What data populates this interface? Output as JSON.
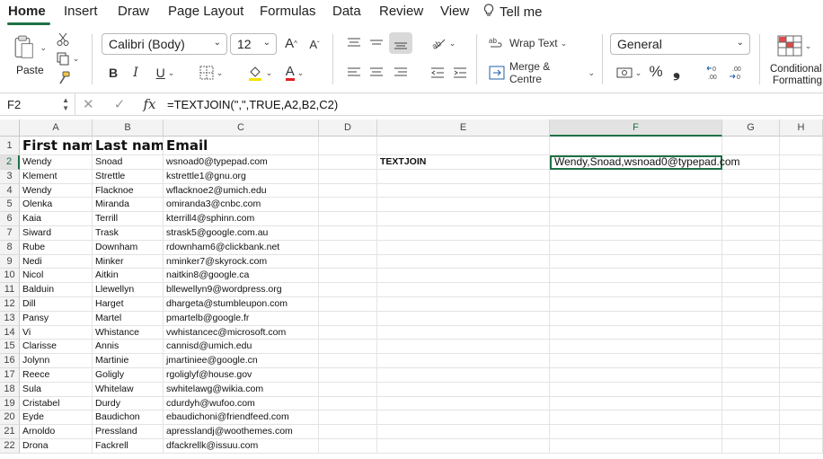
{
  "tabs": [
    "Home",
    "Insert",
    "Draw",
    "Page Layout",
    "Formulas",
    "Data",
    "Review",
    "View",
    "Tell me"
  ],
  "ribbon": {
    "paste": "Paste",
    "font_name": "Calibri (Body)",
    "font_size": "12",
    "wrap_text": "Wrap Text",
    "merge": "Merge & Centre",
    "number_format": "General",
    "conditional": "Conditional",
    "formatting": "Formatting",
    "bold": "B",
    "italic": "I",
    "underline": "U",
    "percent": "%",
    "comma": "❟",
    "font_color": "A",
    "grow": "A",
    "shrink": "A"
  },
  "formula_bar": {
    "name": "F2",
    "fx": "fx",
    "formula": "=TEXTJOIN(\",\",TRUE,A2,B2,C2)"
  },
  "columns": [
    "A",
    "B",
    "C",
    "D",
    "E",
    "F",
    "G",
    "H"
  ],
  "header_row": [
    "First name",
    "Last name",
    "Email"
  ],
  "rows": [
    [
      "Wendy",
      "Snoad",
      "wsnoad0@typepad.com"
    ],
    [
      "Klement",
      "Strettle",
      "kstrettle1@gnu.org"
    ],
    [
      "Wendy",
      "Flacknoe",
      "wflacknoe2@umich.edu"
    ],
    [
      "Olenka",
      "Miranda",
      "omiranda3@cnbc.com"
    ],
    [
      "Kaia",
      "Terrill",
      "kterrill4@sphinn.com"
    ],
    [
      "Siward",
      "Trask",
      "strask5@google.com.au"
    ],
    [
      "Rube",
      "Downham",
      "rdownham6@clickbank.net"
    ],
    [
      "Nedi",
      "Minker",
      "nminker7@skyrock.com"
    ],
    [
      "Nicol",
      "Aitkin",
      "naitkin8@google.ca"
    ],
    [
      "Balduin",
      "Llewellyn",
      "bllewellyn9@wordpress.org"
    ],
    [
      "Dill",
      "Harget",
      "dhargeta@stumbleupon.com"
    ],
    [
      "Pansy",
      "Martel",
      "pmartelb@google.fr"
    ],
    [
      "Vi",
      "Whistance",
      "vwhistancec@microsoft.com"
    ],
    [
      "Clarisse",
      "Annis",
      "cannisd@umich.edu"
    ],
    [
      "Jolynn",
      "Martinie",
      "jmartiniee@google.cn"
    ],
    [
      "Reece",
      "Goligly",
      "rgoliglyf@house.gov"
    ],
    [
      "Sula",
      "Whitelaw",
      "swhitelawg@wikia.com"
    ],
    [
      "Cristabel",
      "Durdy",
      "cdurdyh@wufoo.com"
    ],
    [
      "Eyde",
      "Baudichon",
      "ebaudichoni@friendfeed.com"
    ],
    [
      "Arnoldo",
      "Pressland",
      "apresslandj@woothemes.com"
    ],
    [
      "Drona",
      "Fackrell",
      "dfackrellk@issuu.com"
    ]
  ],
  "label_e2": "TEXTJOIN",
  "result_f2": "Wendy,Snoad,wsnoad0@typepad.com",
  "accent": "#1e7145"
}
